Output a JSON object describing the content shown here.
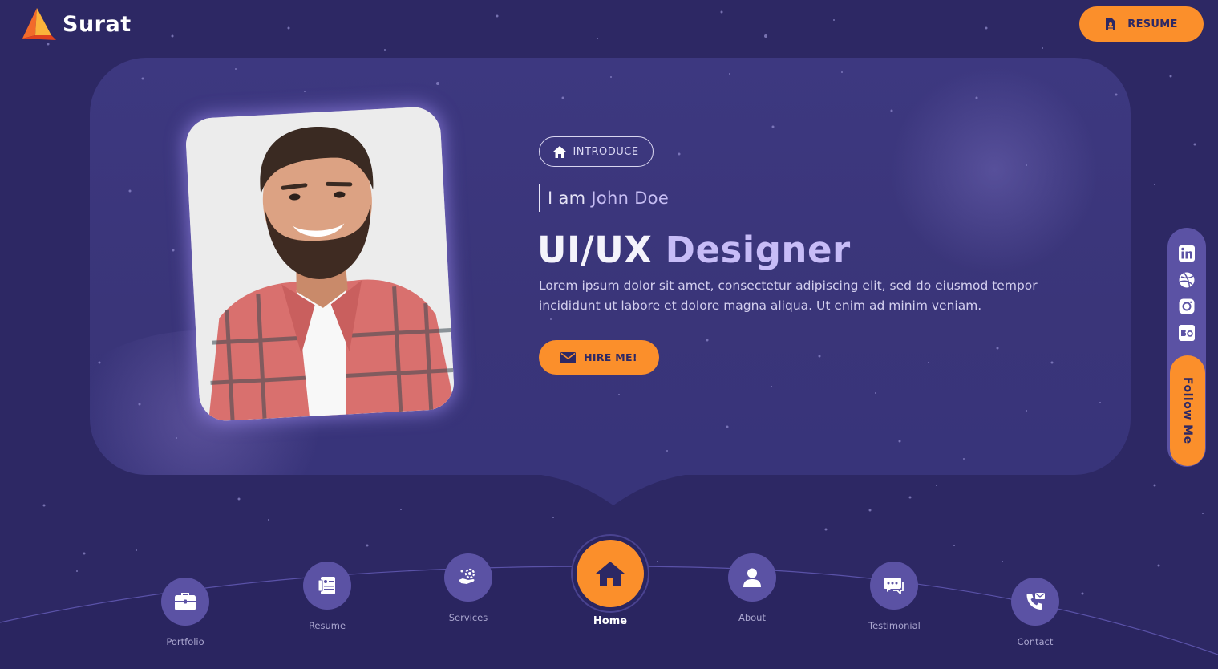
{
  "header": {
    "logo_text": "Surat",
    "resume_label": "RESUME"
  },
  "hero": {
    "badge_label": "INTRODUCE",
    "greeting_prefix": "I am ",
    "greeting_name": "John Doe",
    "title_word1": "UI/UX",
    "title_word2": "Designer",
    "description": "Lorem ipsum dolor sit amet, consectetur adipiscing elit, sed do eiusmod tempor incididunt ut labore et dolore magna aliqua. Ut enim ad minim veniam.",
    "hire_label": "HIRE ME!"
  },
  "social": {
    "icons": [
      "linkedin-icon",
      "dribbble-icon",
      "instagram-icon",
      "behance-icon"
    ],
    "follow_label": "Follow Me"
  },
  "nav": {
    "items": [
      {
        "label": "Portfolio",
        "icon": "briefcase-icon"
      },
      {
        "label": "Resume",
        "icon": "resume-icon"
      },
      {
        "label": "Services",
        "icon": "services-icon"
      },
      {
        "label": "Home",
        "icon": "home-icon"
      },
      {
        "label": "About",
        "icon": "user-icon"
      },
      {
        "label": "Testimonial",
        "icon": "chat-icon"
      },
      {
        "label": "Contact",
        "icon": "phone-icon"
      }
    ],
    "active": "Home"
  },
  "colors": {
    "background": "#2d2864",
    "card": "#3d3880",
    "accent": "#fb8f2b",
    "nav_circle": "#5b52a4",
    "title_highlight": "#c7bcf7"
  }
}
